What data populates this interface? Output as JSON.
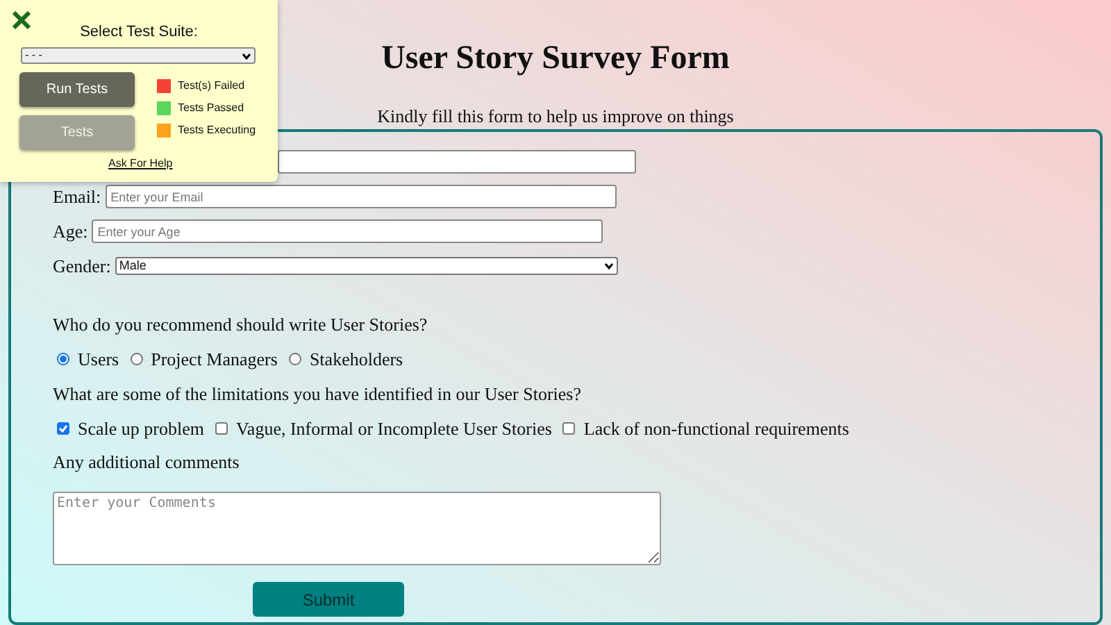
{
  "test_panel": {
    "title": "Select Test Suite:",
    "suite_select": {
      "value": "- - -"
    },
    "buttons": [
      {
        "label": "Run Tests",
        "kind": "primary"
      },
      {
        "label": "Tests",
        "kind": "secondary"
      }
    ],
    "legend": [
      {
        "label": "Test(s) Failed",
        "color": "#f44336"
      },
      {
        "label": "Tests Passed",
        "color": "#5cd65c"
      },
      {
        "label": "Tests Executing",
        "color": "#ffa31a"
      }
    ],
    "help_link": "Ask For Help"
  },
  "title": "User Story Survey Form",
  "subtitle": "Kindly fill this form to help us improve on things",
  "fields": [
    {
      "kind": "text"
    },
    {
      "label": "Email:",
      "kind": "text",
      "placeholder": "Enter your Email"
    },
    {
      "label": "Age:",
      "kind": "text",
      "placeholder": "Enter your Age"
    },
    {
      "label": "Gender:",
      "kind": "select",
      "value": "Male"
    }
  ],
  "writers_question": "Who do you recommend should write User Stories?",
  "writers": [
    {
      "label": "Users",
      "selected": true
    },
    {
      "label": "Project Managers",
      "selected": false
    },
    {
      "label": "Stakeholders",
      "selected": false
    }
  ],
  "limitations_question": "What are some of the limitations you have identified in our User Stories?",
  "limitations": [
    {
      "label": "Scale up problem",
      "checked": true
    },
    {
      "label": "Vague, Informal or Incomplete User Stories",
      "checked": false
    },
    {
      "label": "Lack of non-functional requirements",
      "checked": false
    }
  ],
  "comments": {
    "label": "Any additional comments",
    "placeholder": "Enter your Comments"
  },
  "submit": "Submit"
}
